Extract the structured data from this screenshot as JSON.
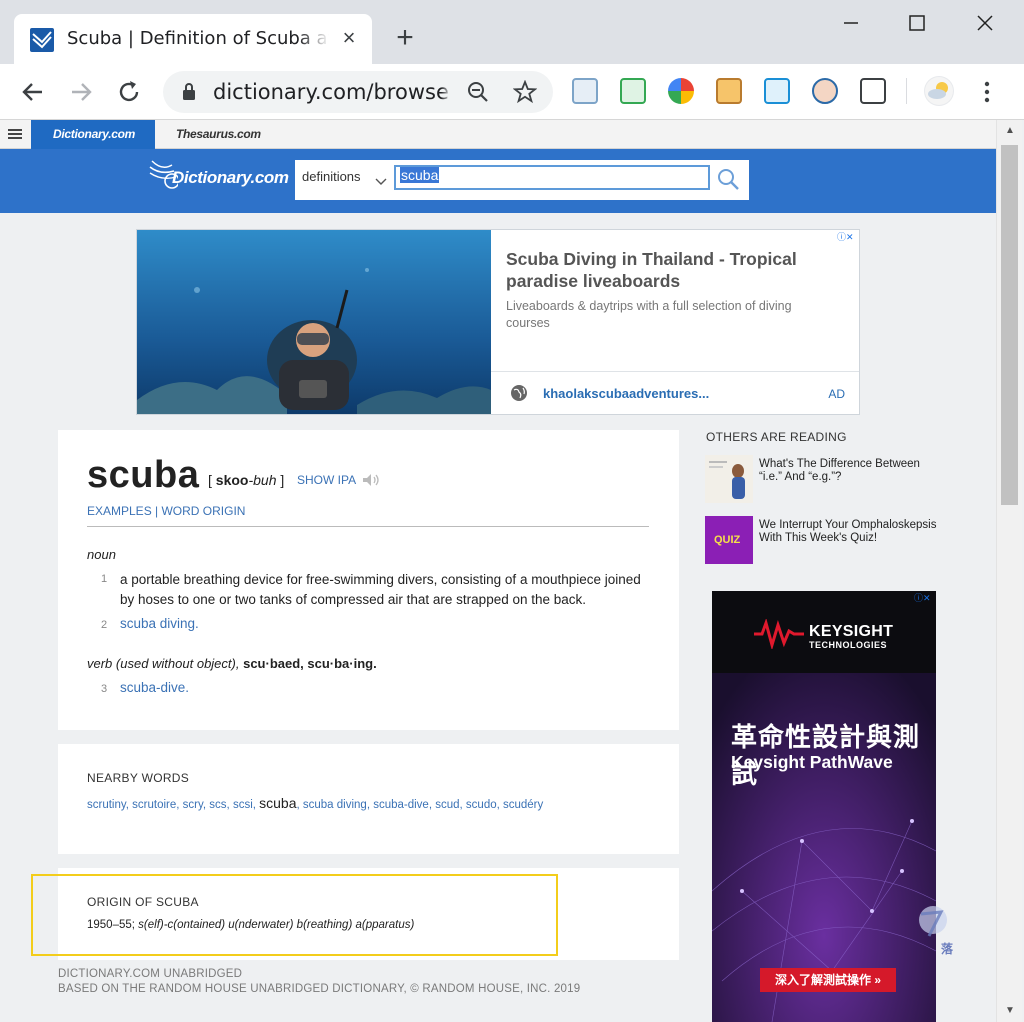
{
  "browser": {
    "tab_title": "Scuba | Definition of Scuba at Dictionary.com",
    "tab_close": "×",
    "new_tab": "+",
    "url": "dictionary.com/browse/scuba"
  },
  "site": {
    "tabs": [
      "Dictionary.com",
      "Thesaurus.com"
    ],
    "logo": "Dictionary.com",
    "search": {
      "category": "definitions",
      "query": "scuba"
    }
  },
  "ad_banner": {
    "title": "Scuba Diving in Thailand - Tropical paradise liveaboards",
    "description": "Liveaboards & daytrips with a full selection of diving courses",
    "domain": "khaolakscubaadventures...",
    "label": "AD"
  },
  "entry": {
    "word": "scuba",
    "pron_open": "[",
    "pron_stressed": "skoo",
    "pron_rest": "-buh",
    "pron_close": "]",
    "show_ipa": "SHOW IPA",
    "links": "EXAMPLES | WORD ORIGIN",
    "pos_noun": "noun",
    "senses": [
      {
        "num": "1",
        "text": "a portable breathing device for free-swimming divers, consisting of a mouthpiece joined by hoses to one or two tanks of compressed air that are strapped on the back."
      },
      {
        "num": "2",
        "text": "scuba diving."
      },
      {
        "num": "3",
        "text": "scuba-dive."
      }
    ],
    "pos_verb": "verb (used without object),",
    "verb_forms": "scu·baed, scu·ba·ing."
  },
  "nearby": {
    "heading": "NEARBY WORDS",
    "words": [
      "scrutiny",
      "scrutoire",
      "scry",
      "scs",
      "scsi",
      "scuba",
      "scuba diving",
      "scuba-dive",
      "scud",
      "scudo",
      "scudéry"
    ]
  },
  "origin": {
    "heading": "ORIGIN OF SCUBA",
    "date": "1950–55;",
    "etymology": "s(elf)-c(ontained) u(nderwater) b(reathing) a(pparatus)"
  },
  "footer": {
    "line1": "DICTIONARY.COM UNABRIDGED",
    "line2": "BASED ON THE RANDOM HOUSE UNABRIDGED DICTIONARY, © RANDOM HOUSE, INC. 2019"
  },
  "sidebar": {
    "heading": "OTHERS ARE READING",
    "items": [
      {
        "title": "What's The Difference Between “i.e.” And “e.g.”?"
      },
      {
        "title": "We Interrupt Your Omphaloskepsis With This Week's Quiz!",
        "thumb_label": "QUIZ"
      }
    ]
  },
  "side_ad": {
    "brand": "KEYSIGHT",
    "brand_sub": "TECHNOLOGIES",
    "headline_cn": "革命性設計與測試",
    "headline_en": "Keysight PathWave",
    "cta": "深入了解測試操作 »"
  },
  "watermark": "落",
  "colors": {
    "brand_blue": "#2e72c9",
    "link": "#3b72b5",
    "highlight": "#f3cd1b",
    "page_bg": "#eef0f2"
  }
}
